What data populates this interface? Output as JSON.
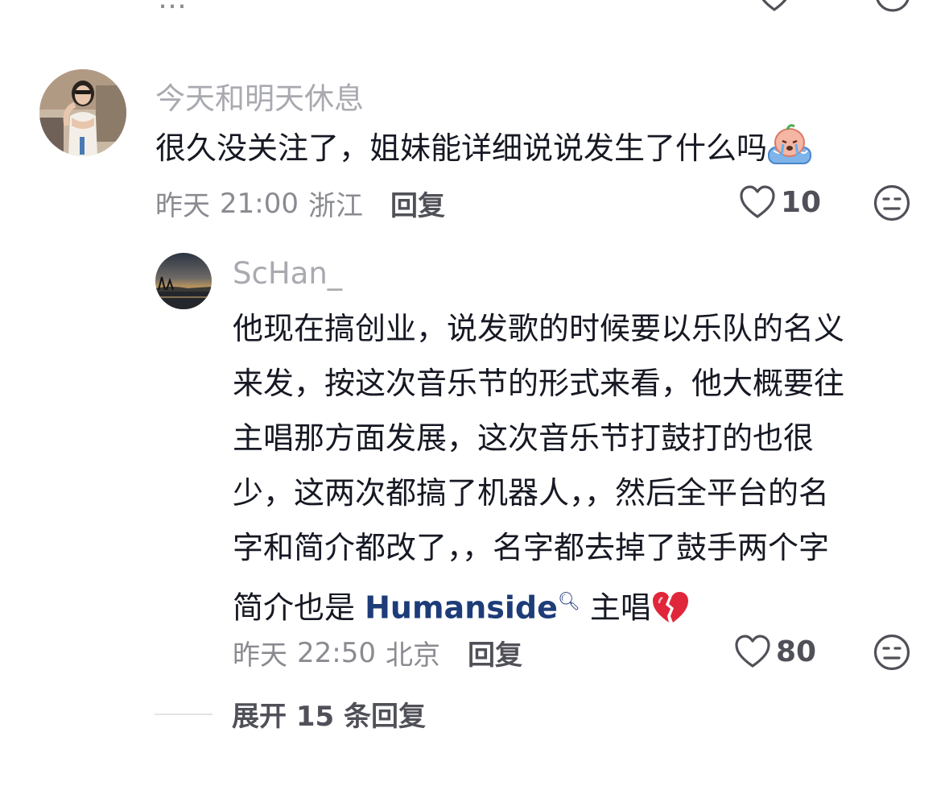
{
  "top_cut": {
    "text": "…"
  },
  "comment": {
    "username": "今天和明天休息",
    "text": "很久没关注了，姐妹能详细说说发生了什么吗",
    "emoji": "crying-face-emoji",
    "date": "昨天",
    "time": "21:00",
    "location": "浙江",
    "reply_label": "回复",
    "like_count": "10"
  },
  "reply": {
    "username": "ScHan_",
    "lines": [
      "他现在搞创业，说发歌的时候要以乐队的名义",
      "来发，按这次音乐节的形式来看，他大概要往",
      "主唱那方面发展，这次音乐节打鼓打的也很",
      "少，这两次都搞了机器人，，然后全平台的名",
      "字和简介都改了，，名字都去掉了鼓手两个字"
    ],
    "last_line_prefix": "简介也是 ",
    "mention": "Humanside",
    "last_line_suffix": " 主唱",
    "emoji": "broken-heart-emoji",
    "date": "昨天",
    "time": "22:50",
    "location": "北京",
    "reply_label": "回复",
    "like_count": "80"
  },
  "expand": {
    "label": "展开 15 条回复"
  },
  "colors": {
    "text_primary": "#161823",
    "text_secondary": "#8a8b91",
    "username": "#a9aab0",
    "mention": "#1d3c78",
    "broken_heart": "#e0263a"
  }
}
